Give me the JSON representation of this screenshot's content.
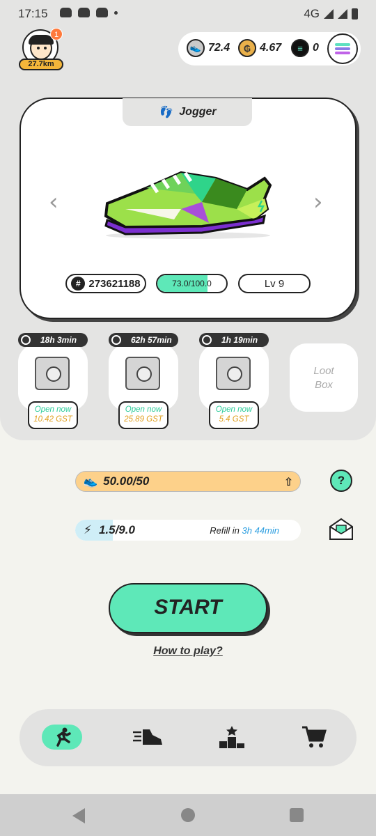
{
  "status_bar": {
    "time": "17:15",
    "network": "4G"
  },
  "profile": {
    "notification_count": "1",
    "distance": "27.7km"
  },
  "balances": {
    "gst": "72.4",
    "gmt": "4.67",
    "sol": "0"
  },
  "sneaker": {
    "type": "Jogger",
    "id": "273621188",
    "durability": "73.0/100.0",
    "durability_fraction": 0.73,
    "level": "Lv 9"
  },
  "mystery_boxes": [
    {
      "timer": "18h 3min",
      "action": "Open now",
      "cost": "10.42 GST"
    },
    {
      "timer": "62h 57min",
      "action": "Open now",
      "cost": "25.89 GST"
    },
    {
      "timer": "1h 19min",
      "action": "Open now",
      "cost": "5.4 GST"
    }
  ],
  "loot_box": {
    "label_line1": "Loot",
    "label_line2": "Box"
  },
  "energy": {
    "value": "50.00/50"
  },
  "durability_energy": {
    "value": "1.5/9.0",
    "fraction": 0.1667,
    "refill_label": "Refill in",
    "refill_time": "3h 44min"
  },
  "help_label": "?",
  "start_label": "START",
  "how_to_play": "How to play?",
  "colors": {
    "accent": "#5ee8b8",
    "energy": "#fdd18a",
    "gold": "#e0a020"
  }
}
